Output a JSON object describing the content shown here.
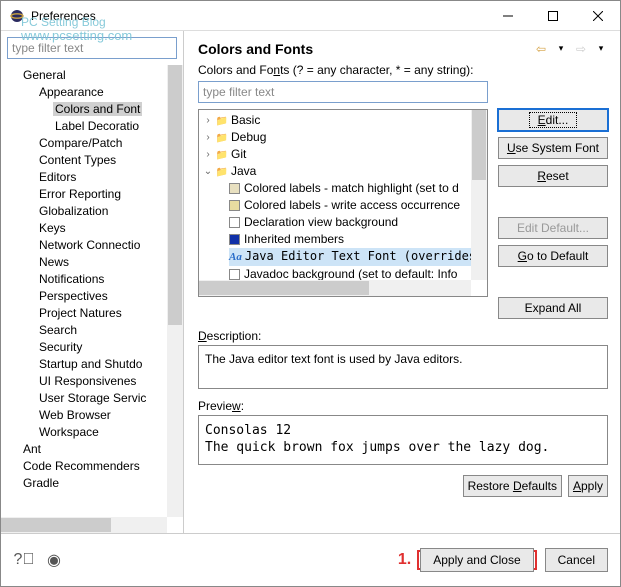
{
  "watermark": {
    "main": "PC Setting Blog",
    "url": "www.pcsetting.com"
  },
  "window": {
    "title": "Preferences"
  },
  "left": {
    "filter_placeholder": "type filter text",
    "tree": [
      {
        "label": "General",
        "expanded": true,
        "children": [
          {
            "label": "Appearance",
            "expanded": true,
            "children": [
              {
                "label": "Colors and Font",
                "selected": true
              },
              {
                "label": "Label Decoratio"
              }
            ]
          },
          {
            "label": "Compare/Patch"
          },
          {
            "label": "Content Types"
          },
          {
            "label": "Editors",
            "expandable": true
          },
          {
            "label": "Error Reporting"
          },
          {
            "label": "Globalization"
          },
          {
            "label": "Keys"
          },
          {
            "label": "Network Connectio",
            "expandable": true
          },
          {
            "label": "News"
          },
          {
            "label": "Notifications"
          },
          {
            "label": "Perspectives"
          },
          {
            "label": "Project Natures"
          },
          {
            "label": "Search"
          },
          {
            "label": "Security",
            "expandable": true
          },
          {
            "label": "Startup and Shutdo",
            "expandable": true
          },
          {
            "label": "UI Responsivenes"
          },
          {
            "label": "User Storage Servic",
            "expandable": true
          },
          {
            "label": "Web Browser"
          },
          {
            "label": "Workspace",
            "expandable": true
          }
        ]
      },
      {
        "label": "Ant",
        "expandable": true
      },
      {
        "label": "Code Recommenders",
        "expandable": true
      },
      {
        "label": "Gradle",
        "expandable": true
      }
    ]
  },
  "right": {
    "header": "Colors and Fonts",
    "hint_prefix": "Colors and Fo",
    "hint_uchar": "n",
    "hint_suffix": "ts (? = any character, * = any string):",
    "filter_placeholder": "type filter text",
    "font_tree": [
      {
        "label": "Basic",
        "icon": "folder",
        "expandable": true
      },
      {
        "label": "Debug",
        "icon": "folder",
        "expandable": true
      },
      {
        "label": "Git",
        "icon": "folder",
        "expandable": true
      },
      {
        "label": "Java",
        "icon": "folder",
        "expanded": true,
        "children": [
          {
            "label": "Colored labels - match highlight (set to d",
            "swatch": "#e8e0c0"
          },
          {
            "label": "Colored labels - write access occurrence",
            "swatch": "#e8dca0"
          },
          {
            "label": "Declaration view background",
            "swatch": "#ffffff"
          },
          {
            "label": "Inherited members",
            "swatch": "#1030a8"
          },
          {
            "label": "Java Editor Text Font (overrides",
            "aa": true,
            "selected": true,
            "mono": true
          },
          {
            "label": "Javadoc background (set to default: Info",
            "swatch": "#ffffff"
          }
        ]
      }
    ],
    "buttons": {
      "edit": "Edit...",
      "use_system": "Use System Font",
      "reset": "Reset",
      "edit_default": "Edit Default...",
      "go_default": "Go to Default",
      "expand_all": "Expand All"
    },
    "description_label": "Description:",
    "description_text": "The Java editor text font is used by Java editors.",
    "preview_label_pre": "Previe",
    "preview_label_u": "w",
    "preview_label_post": ":",
    "preview_text": "Consolas 12\nThe quick brown fox jumps over the lazy dog.",
    "restore_defaults_pre": "Restore ",
    "restore_defaults_u": "D",
    "restore_defaults_post": "efaults",
    "apply_u": "A",
    "apply_post": "pply"
  },
  "bottom": {
    "red_num": "1.",
    "apply_close": "Apply and Close",
    "cancel": "Cancel"
  }
}
